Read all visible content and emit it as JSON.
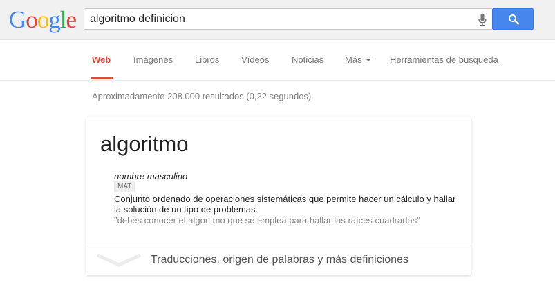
{
  "logo": {
    "letters": [
      "G",
      "o",
      "o",
      "g",
      "l",
      "e"
    ],
    "colors": [
      "#4285f4",
      "#ea4335",
      "#fbbc05",
      "#4285f4",
      "#34a853",
      "#ea4335"
    ]
  },
  "search": {
    "query": "algoritmo definicion",
    "mic_icon": "microphone-icon",
    "button_icon": "search-icon",
    "button_color": "#4787ed"
  },
  "tabs": [
    {
      "label": "Web",
      "active": true
    },
    {
      "label": "Imágenes",
      "active": false
    },
    {
      "label": "Libros",
      "active": false
    },
    {
      "label": "Vídeos",
      "active": false
    },
    {
      "label": "Noticias",
      "active": false
    },
    {
      "label": "Más",
      "active": false
    },
    {
      "label": "Herramientas de búsqueda",
      "active": false
    }
  ],
  "accent_color": "#dd4b39",
  "result_stats": "Aproximadamente 208.000 resultados (0,22 segundos)",
  "definition": {
    "word": "algoritmo",
    "part_of_speech": "nombre masculino",
    "domain_badge": "MAT",
    "meaning": "Conjunto ordenado de operaciones sistemáticas que permite hacer un cálculo y hallar la solución de un tipo de problemas.",
    "example": "\"debes conocer el algoritmo que se emplea para hallar las raíces cuadradas\"",
    "more_link": "Traducciones, origen de palabras y más definiciones",
    "expand_icon": "chevron-down-icon"
  }
}
